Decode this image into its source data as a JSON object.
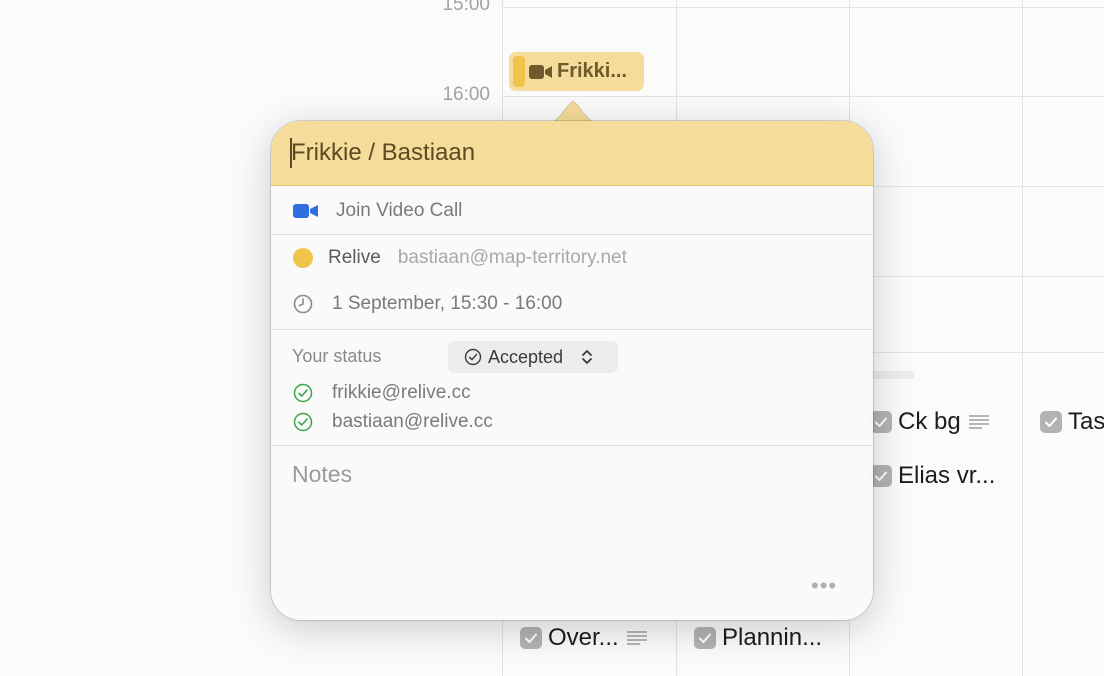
{
  "calendar": {
    "hours": [
      "15:00",
      "16:00"
    ],
    "event_chip_title": "Frikki...",
    "event_color": "#f5dc9a",
    "event_bar_color": "#f0c34a"
  },
  "reminders": [
    {
      "label": "Ck bg",
      "has_notes": true
    },
    {
      "label": "Tas",
      "has_notes": false
    },
    {
      "label": "Elias vr...",
      "has_notes": false
    },
    {
      "label": "Over...",
      "has_notes": true
    },
    {
      "label": "Plannin...",
      "has_notes": false
    }
  ],
  "popover": {
    "title": "Frikkie / Bastiaan",
    "join_video_call": "Join Video Call",
    "calendar_name": "Relive",
    "calendar_account": "bastiaan@map-territory.net",
    "calendar_color": "#f0c34a",
    "datetime": "1 September, 15:30 - 16:00",
    "status_label": "Your status",
    "status_value": "Accepted",
    "attendees": [
      "frikkie@relive.cc",
      "bastiaan@relive.cc"
    ],
    "notes_placeholder": "Notes",
    "more": "•••",
    "icons": {
      "video": "video-camera-icon",
      "clock": "clock-icon",
      "accepted": "checkmark-circle-icon",
      "stepper": "chevron-updown-icon"
    },
    "accent_blue": "#2f6fe0",
    "accepted_green": "#3aa54a"
  }
}
